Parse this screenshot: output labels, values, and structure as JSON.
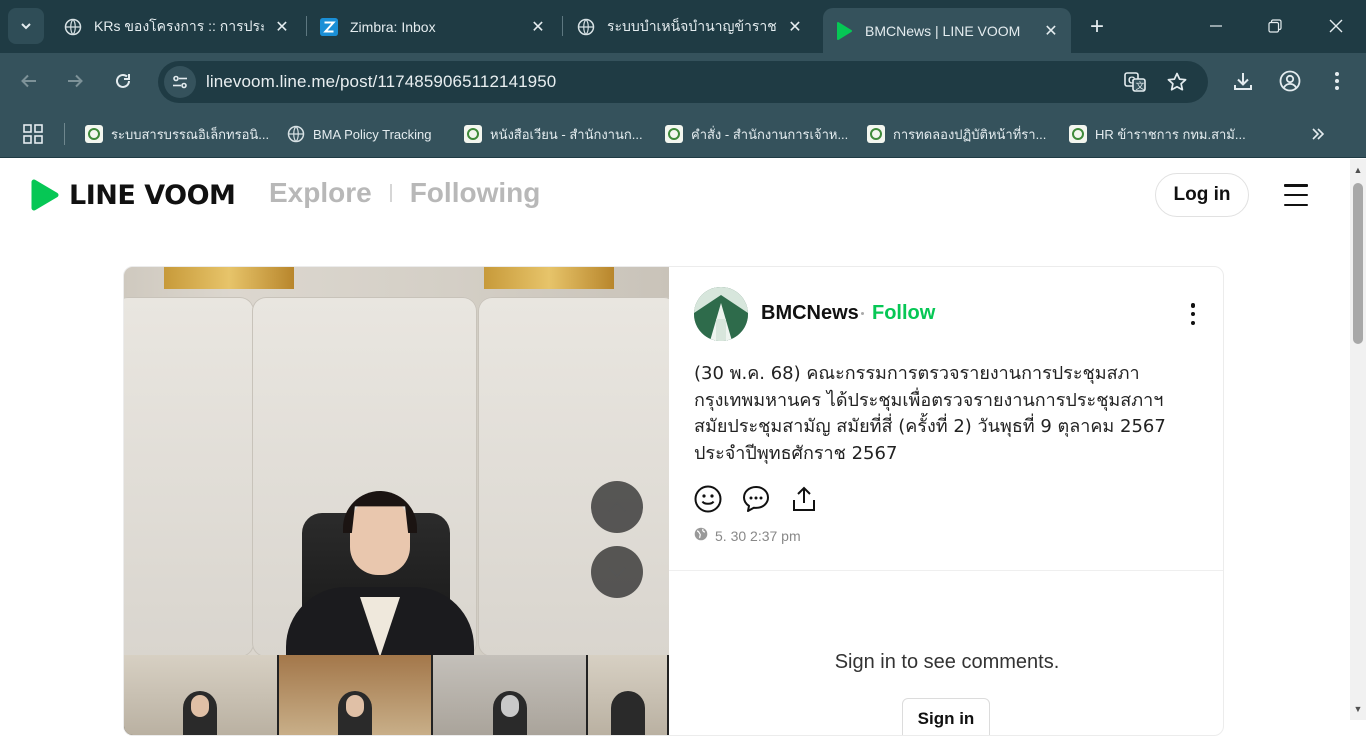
{
  "browser": {
    "tabs": [
      {
        "title": "KRs ของโครงการ :: การประชา",
        "active": false
      },
      {
        "title": "Zimbra: Inbox",
        "active": false
      },
      {
        "title": "ระบบบำเหน็จบำนาญข้าราชกา",
        "active": false
      },
      {
        "title": "BMCNews | LINE VOOM",
        "active": true
      }
    ],
    "url": "linevoom.line.me/post/1174859065112141950",
    "bookmarks": [
      "ระบบสารบรรณอิเล็กทรอนิ...",
      "BMA Policy Tracking",
      "หนังสือเวียน - สำนักงานก...",
      "คำสั่ง - สำนักงานการเจ้าห...",
      "การทดลองปฏิบัติหน้าที่รา...",
      "HR ข้าราชการ กทม.สามั..."
    ],
    "colors": {
      "frame": "#1f3b44",
      "toolbar": "#35525c"
    }
  },
  "header": {
    "logo_text": "LINE VOOM",
    "nav": [
      "Explore",
      "Following"
    ],
    "login_label": "Log in"
  },
  "post": {
    "author": "BMCNews",
    "follow_label": "Follow",
    "text": "(30 พ.ค. 68) คณะกรรมการตรวจรายงานการประชุมสภา\nกรุงเทพมหานคร ได้ประชุมเพื่อตรวจรายงานการประชุมสภาฯ\nสมัยประชุมสามัญ สมัยที่สี่ (ครั้งที่ 2) วันพุธที่ 9 ตุลาคม 2567\nประจำปีพุทธศักราช 2567",
    "timestamp": "5. 30 2:37 pm",
    "actions": [
      "smile-icon",
      "comment-icon",
      "share-icon"
    ]
  },
  "comments": {
    "prompt": "Sign in to see comments.",
    "signin_label": "Sign in"
  },
  "colors": {
    "accent": "#06c755"
  }
}
